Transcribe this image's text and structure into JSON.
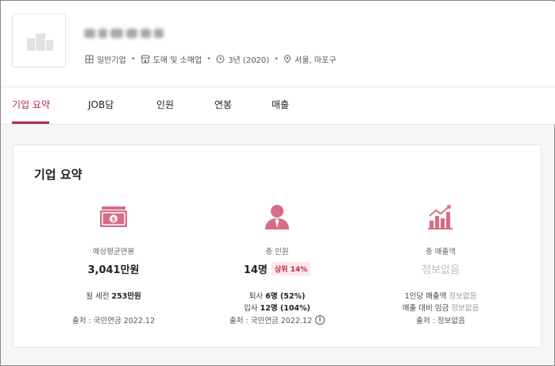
{
  "header": {
    "company_name": "",
    "meta": {
      "company_type": "일반기업",
      "industry": "도매 및 소매업",
      "years": "3년 (2020)",
      "location": "서울, 마포구"
    }
  },
  "tabs": [
    {
      "label": "기업 요약",
      "active": true
    },
    {
      "label": "JOB담",
      "active": false
    },
    {
      "label": "인원",
      "active": false
    },
    {
      "label": "연봉",
      "active": false
    },
    {
      "label": "매출",
      "active": false
    }
  ],
  "summary": {
    "title": "기업 요약",
    "salary": {
      "label": "예상평균연봉",
      "value": "3,041만원",
      "monthly_prefix": "월 세전",
      "monthly_value": "253만원",
      "source": "출처 : 국민연금 2022.12"
    },
    "employees": {
      "label": "총 인원",
      "value": "14명",
      "rank_badge": "상위 14%",
      "resign_prefix": "퇴사",
      "resign_value": "6명 (52%)",
      "join_prefix": "입사",
      "join_value": "12명 (104%)",
      "source": "출처 : 국민연금 2022.12",
      "info_icon_glyph": "i"
    },
    "revenue": {
      "label": "총 매출액",
      "value": "정보없음",
      "per_person_label": "1인당 매출액",
      "per_person_value": "정보없음",
      "ratio_label": "매출 대비 임금",
      "ratio_value": "정보없음",
      "source": "출처 : 정보없음"
    }
  },
  "colors": {
    "accent": "#b3294a",
    "icon_pink": "#d86b85",
    "badge_bg": "#fbe7ec"
  },
  "icons": [
    "building-icon",
    "store-icon",
    "clock-icon",
    "location-pin-icon",
    "money-icon",
    "person-icon",
    "growth-chart-icon",
    "info-icon"
  ]
}
